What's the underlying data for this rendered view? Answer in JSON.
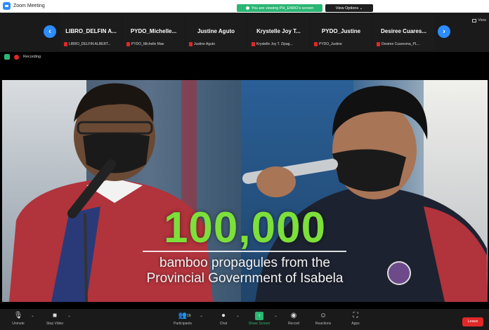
{
  "window": {
    "title": "Zoom Meeting"
  },
  "share_banner": {
    "text": "You are viewing PH_ENRO's screen"
  },
  "view_options": {
    "label": "View Options"
  },
  "gallery": {
    "view_label": "View",
    "tiles": [
      {
        "name": "LIBRO_DELFIN A...",
        "label": "LIBRO_DELFIN ALBERT..."
      },
      {
        "name": "PYDO_Michelle...",
        "label": "PYDO_Michelle Mae"
      },
      {
        "name": "Justine Aguto",
        "label": "Justine Aguto"
      },
      {
        "name": "Krystelle Joy T...",
        "label": "Krystelle Joy T. Zipag..."
      },
      {
        "name": "PYDO_Justine",
        "label": "PYDO_Justine"
      },
      {
        "name": "Desiree Cuares...",
        "label": "Desiree Cuaresma_PL..."
      }
    ]
  },
  "recording": {
    "label": "Recording"
  },
  "shared_video": {
    "number": "100,000",
    "line1": "bamboo propagules from the",
    "line2": "Provincial Government of Isabela"
  },
  "toolbar": {
    "unmute": "Unmute",
    "stop_video": "Stop Video",
    "participants": "Participants",
    "participants_count": "19",
    "chat": "Chat",
    "share_screen": "Share Screen",
    "record": "Record",
    "reactions": "Reactions",
    "apps": "Apps",
    "leave": "Leave"
  },
  "colors": {
    "accent": "#2d8cff",
    "share_green": "#2bb673",
    "leave_red": "#e02828",
    "overlay_green": "#7ddf3a"
  }
}
